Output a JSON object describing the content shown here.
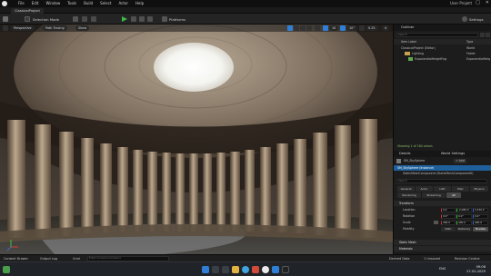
{
  "app": {
    "menu": [
      "File",
      "Edit",
      "Window",
      "Tools",
      "Build",
      "Select",
      "Actor",
      "Help"
    ],
    "project_name": "User Project",
    "tab_title": "ClassicalProject"
  },
  "toolbar": {
    "mode": "Selection Mode",
    "platforms": "Platforms",
    "settings": "Settings"
  },
  "viewport": {
    "perspective": "Perspective",
    "path_tracing": "Path Tracing",
    "show": "Show",
    "snap_value": "10",
    "angle_value": "10°",
    "scale_value": "0.25",
    "camera_speed": "4"
  },
  "outliner": {
    "title": "Outliner",
    "search_placeholder": "Search",
    "col_label": "Item Label",
    "col_type": "Type",
    "rows": [
      {
        "label": "ClassicalProject (Editor)",
        "type": "World"
      },
      {
        "label": "Lighting",
        "type": "Folder"
      },
      {
        "label": "ExponentialHeightFog",
        "type": "ExponentialHeightFog"
      }
    ],
    "actor_count": "Showing 1 of 184 actors"
  },
  "details": {
    "tab_details": "Details",
    "tab_world_settings": "World Settings",
    "actor_name": "SM_SkySphere",
    "add_label": "+ Add",
    "instance_row": "SM_SkySphere (Instance)",
    "component_row": "StaticMeshComponent (StaticMeshComponent0)",
    "search_placeholder": "Search",
    "categories_row1": [
      "General",
      "Actor",
      "LOD",
      "Misc",
      "Physics"
    ],
    "categories_row2": [
      "Rendering",
      "Streaming",
      "All"
    ],
    "transform_header": "Transform",
    "location_label": "Location",
    "rotation_label": "Rotation",
    "scale_label": "Scale",
    "location": [
      "0.0",
      "-2,080.0",
      "2,430.0"
    ],
    "rotation": [
      "0.0°",
      "0.0°",
      "0.0°"
    ],
    "scale": [
      "400.0",
      "400.0",
      "400.0"
    ],
    "mobility_label": "Mobility",
    "mobility_options": [
      "Static",
      "Stationary",
      "Movable"
    ],
    "static_mesh_header": "Static Mesh",
    "materials_header": "Materials"
  },
  "statusbar": {
    "content_drawer": "Content Drawer",
    "output_log": "Output Log",
    "cmd": "Cmd",
    "console_placeholder": "Enter Console Command",
    "derived_data": "Derived Data",
    "unsaved": "1 Unsaved",
    "revision_control": "Revision Control"
  },
  "taskbar": {
    "lang": "ENG",
    "region": "IN",
    "time": "09:06",
    "date": "27-02-2025"
  },
  "colors": {
    "accent": "#2f7fd6",
    "play": "#3fb84a",
    "selection": "#1f5f9a"
  }
}
